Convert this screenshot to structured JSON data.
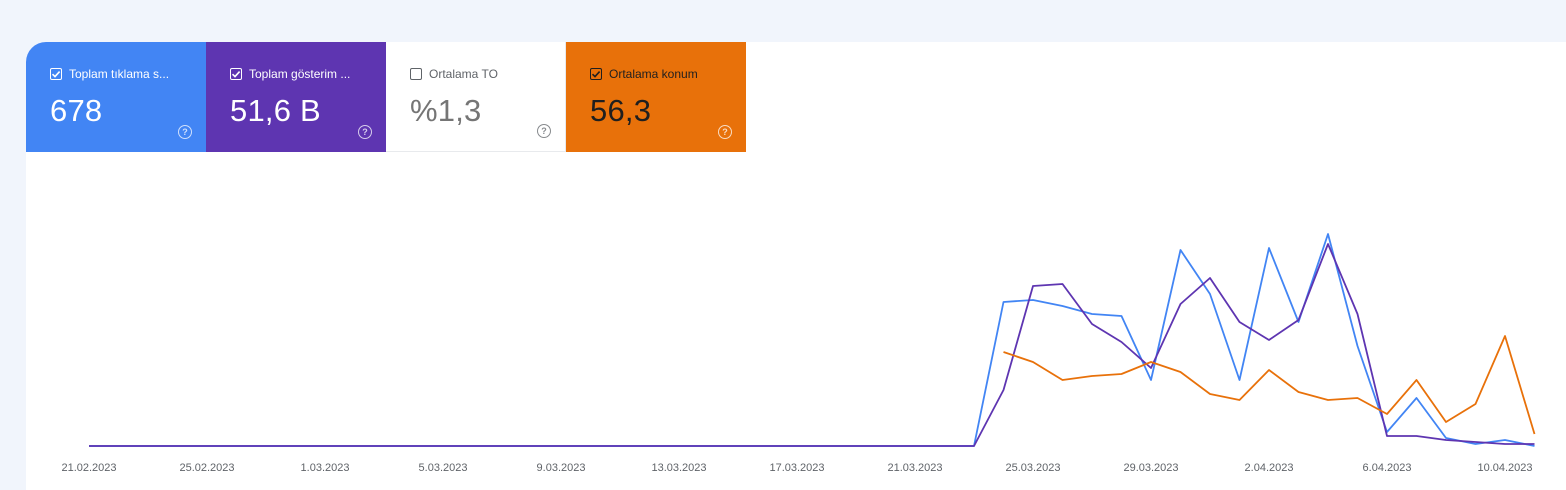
{
  "metrics": [
    {
      "label": "Toplam tıklama s...",
      "value": "678",
      "checked": true,
      "color": "#4285f4"
    },
    {
      "label": "Toplam gösterim ...",
      "value": "51,6 B",
      "checked": true,
      "color": "#5e35b1"
    },
    {
      "label": "Ortalama TO",
      "value": "%1,3",
      "checked": false,
      "color": "#ffffff"
    },
    {
      "label": "Ortalama konum",
      "value": "56,3",
      "checked": true,
      "color": "#e8710a"
    }
  ],
  "help_glyph": "?",
  "chart_data": {
    "type": "line",
    "x_ticks": [
      "21.02.2023",
      "25.02.2023",
      "1.03.2023",
      "5.03.2023",
      "9.03.2023",
      "13.03.2023",
      "17.03.2023",
      "21.03.2023",
      "25.03.2023",
      "29.03.2023",
      "2.04.2023",
      "6.04.2023",
      "10.04.2023"
    ],
    "x_start": "21.02.2023",
    "x_end": "11.04.2023",
    "series": [
      {
        "color": "#4285f4",
        "start_day": 0,
        "values": [
          0,
          0,
          0,
          0,
          0,
          0,
          0,
          0,
          0,
          0,
          0,
          0,
          0,
          0,
          0,
          0,
          0,
          0,
          0,
          0,
          0,
          0,
          0,
          0,
          0,
          0,
          0,
          0,
          0,
          0,
          0,
          72,
          73,
          70,
          66,
          65,
          33,
          98,
          76,
          33,
          99,
          62,
          106,
          50,
          7,
          24,
          4,
          1,
          3,
          0
        ]
      },
      {
        "color": "#5e35b1",
        "start_day": 0,
        "values": [
          0,
          0,
          0,
          0,
          0,
          0,
          0,
          0,
          0,
          0,
          0,
          0,
          0,
          0,
          0,
          0,
          0,
          0,
          0,
          0,
          0,
          0,
          0,
          0,
          0,
          0,
          0,
          0,
          0,
          0,
          0,
          28,
          80,
          81,
          61,
          52,
          39,
          71,
          84,
          62,
          53,
          63,
          101,
          66,
          5,
          5,
          3,
          2,
          1,
          1
        ]
      },
      {
        "color": "#e8710a",
        "start_day": 31,
        "values": [
          47,
          42,
          33,
          35,
          36,
          42,
          37,
          26,
          23,
          38,
          27,
          23,
          24,
          16,
          33,
          12,
          21,
          55,
          6
        ]
      }
    ]
  }
}
